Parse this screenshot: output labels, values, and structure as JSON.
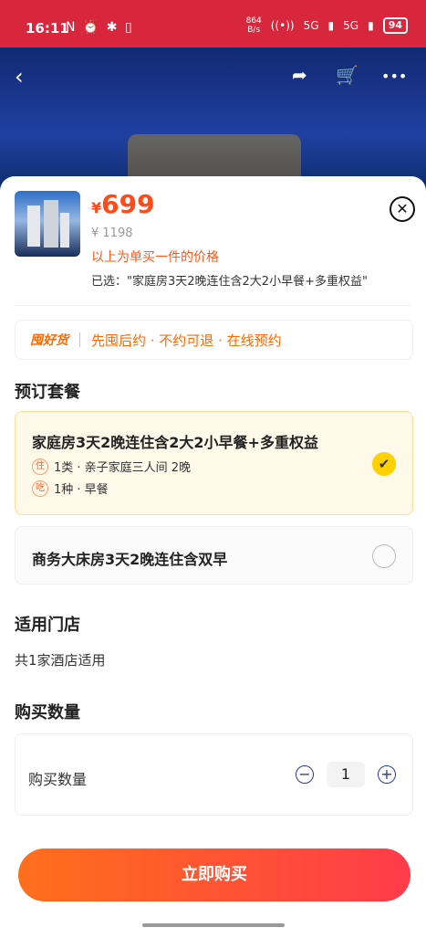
{
  "status_bar": {
    "time": "16:11",
    "left_icons": "N ⏰ ✱ ▯",
    "net_speed_value": "864",
    "net_speed_unit": "B/s",
    "signal1": "5G",
    "signal2": "5G",
    "battery": "94"
  },
  "top_actions": {
    "back_icon": "‹",
    "share_icon": "➦",
    "cart_icon": "🛒",
    "more_icon": "•••"
  },
  "product": {
    "currency": "¥",
    "price": "699",
    "original_price": "¥ 1198",
    "single_price_note": "以上为单买一件的价格",
    "selected_text": "已选：\"家庭房3天2晚连住含2大2小早餐+多重权益\"",
    "close_icon": "✕"
  },
  "promo": {
    "tag": "囤好货",
    "text": "先囤后约 · 不约可退 · 在线预约"
  },
  "package_section": {
    "title": "预订套餐",
    "options": [
      {
        "title": "家庭房3天2晚连住含2大2小早餐+多重权益",
        "badge1": "住",
        "line1": "1类 · 亲子家庭三人间 2晚",
        "badge2": "吃",
        "line2": "1种 · 早餐",
        "check_icon": "✔"
      },
      {
        "title": "商务大床房3天2晚连住含双早"
      }
    ]
  },
  "stores": {
    "title": "适用门店",
    "text": "共1家酒店适用"
  },
  "quantity": {
    "section_title": "购买数量",
    "label": "购买数量",
    "minus": "−",
    "value": "1",
    "plus": "+"
  },
  "buy_button": "立即购买"
}
